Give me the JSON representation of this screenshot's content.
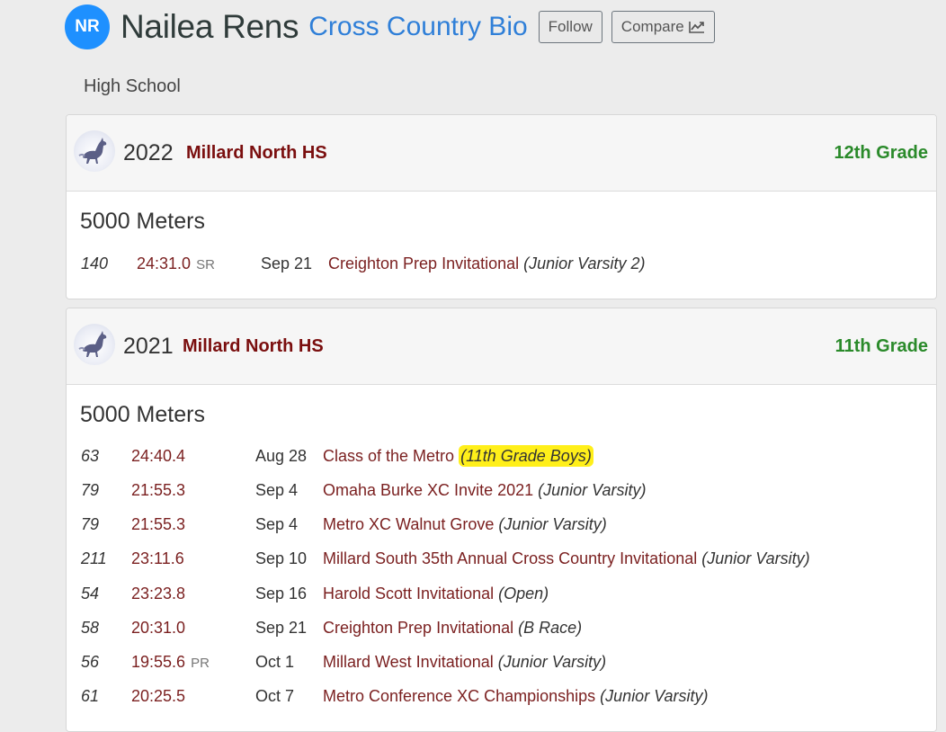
{
  "athlete": {
    "initials": "NR",
    "name": "Nailea Rens",
    "page_title": "Cross Country Bio",
    "follow_label": "Follow",
    "compare_label": "Compare",
    "level": "High School"
  },
  "seasons": [
    {
      "year": "2022",
      "school": "Millard North HS",
      "grade": "12th Grade",
      "event": "5000 Meters",
      "results": [
        {
          "place": "140",
          "time": "24:31.0",
          "tag": "SR",
          "date": "Sep 21",
          "meet": "Creighton Prep Invitational",
          "division": "(Junior Varsity 2)"
        }
      ]
    },
    {
      "year": "2021",
      "school": "Millard North HS",
      "grade": "11th Grade",
      "event": "5000 Meters",
      "results": [
        {
          "place": "63",
          "time": "24:40.4",
          "tag": "",
          "date": "Aug 28",
          "meet": "Class of the Metro",
          "division": "(11th Grade Boys)"
        },
        {
          "place": "79",
          "time": "21:55.3",
          "tag": "",
          "date": "Sep 4",
          "meet": "Omaha Burke XC Invite 2021",
          "division": "(Junior Varsity)"
        },
        {
          "place": "79",
          "time": "21:55.3",
          "tag": "",
          "date": "Sep 4",
          "meet": "Metro XC Walnut Grove",
          "division": "(Junior Varsity)"
        },
        {
          "place": "211",
          "time": "23:11.6",
          "tag": "",
          "date": "Sep 10",
          "meet": "Millard South 35th Annual Cross Country Invitational",
          "division": "(Junior Varsity)"
        },
        {
          "place": "54",
          "time": "23:23.8",
          "tag": "",
          "date": "Sep 16",
          "meet": "Harold Scott Invitational",
          "division": "(Open)"
        },
        {
          "place": "58",
          "time": "20:31.0",
          "tag": "",
          "date": "Sep 21",
          "meet": "Creighton Prep Invitational",
          "division": "(B Race)"
        },
        {
          "place": "56",
          "time": "19:55.6",
          "tag": "PR",
          "date": "Oct 1",
          "meet": "Millard West Invitational",
          "division": "(Junior Varsity)"
        },
        {
          "place": "61",
          "time": "20:25.5",
          "tag": "",
          "date": "Oct 7",
          "meet": "Metro Conference XC Championships",
          "division": "(Junior Varsity)"
        }
      ]
    }
  ],
  "colors": {
    "avatar": "#1e90ff",
    "bio_link": "#2f7fd8",
    "school": "#7a0e0e",
    "grade": "#2a8a2a",
    "highlight": "#ffef1a"
  },
  "icons": [
    "trend-chart-icon",
    "mustang-logo-icon"
  ]
}
